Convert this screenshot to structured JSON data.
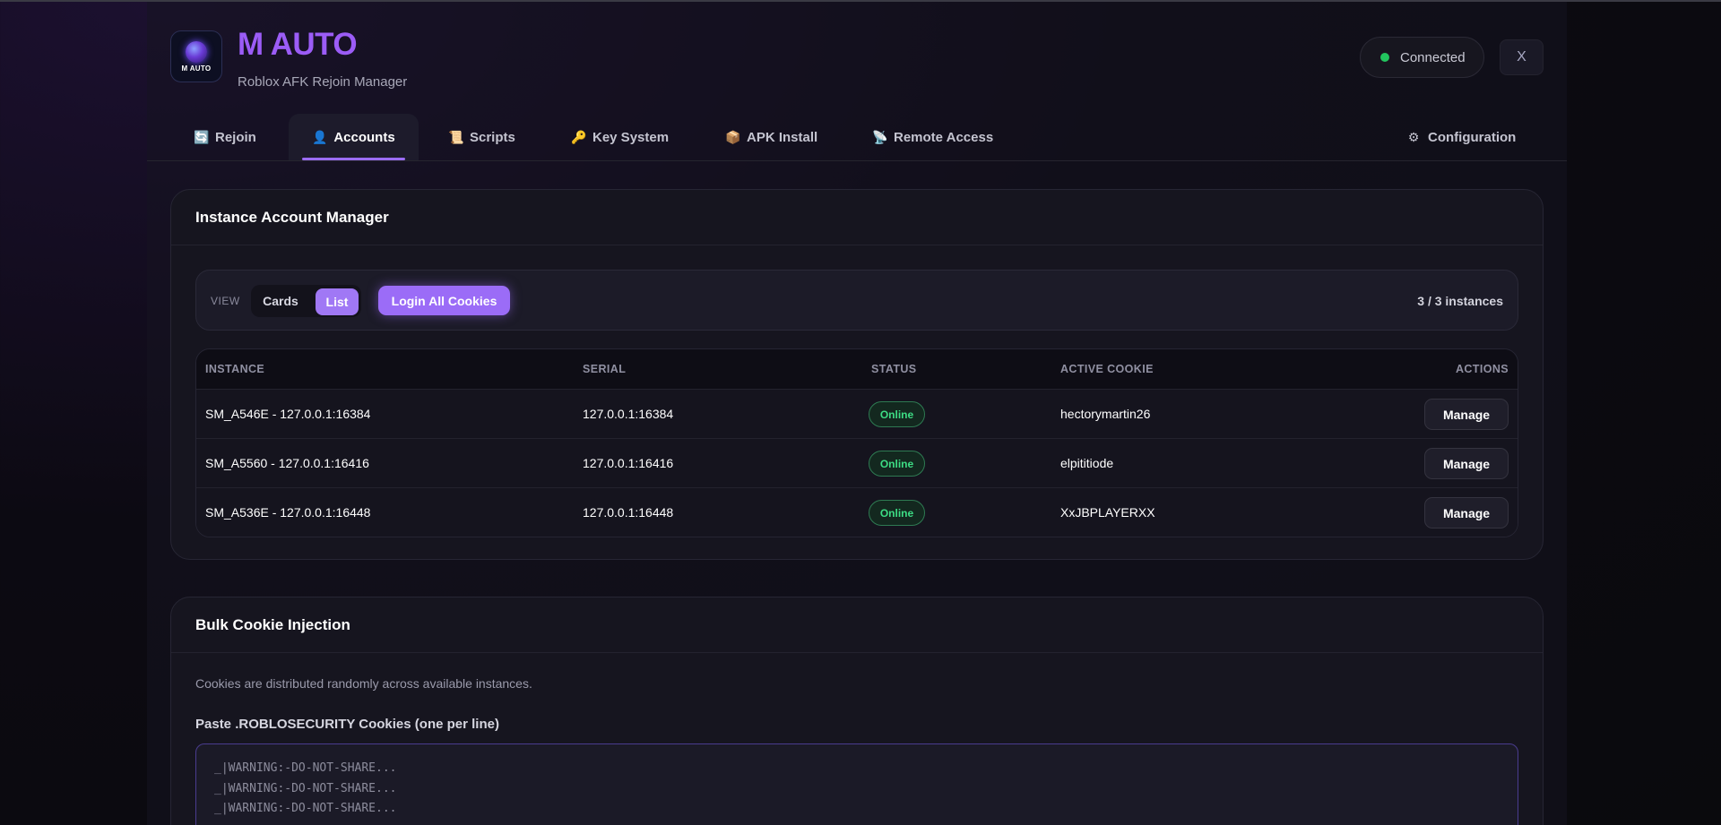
{
  "app": {
    "logo_text": "M AUTO",
    "title": "M AUTO",
    "subtitle": "Roblox AFK Rejoin Manager",
    "status": "Connected",
    "close_label": "X"
  },
  "tabs": [
    {
      "icon": "🔄",
      "label": "Rejoin"
    },
    {
      "icon": "👤",
      "label": "Accounts"
    },
    {
      "icon": "📜",
      "label": "Scripts"
    },
    {
      "icon": "🔑",
      "label": "Key System"
    },
    {
      "icon": "📦",
      "label": "APK Install"
    },
    {
      "icon": "📡",
      "label": "Remote Access"
    },
    {
      "icon": "⚙",
      "label": "Configuration"
    }
  ],
  "active_tab": "Accounts",
  "accounts": {
    "title": "Instance Account Manager",
    "view_label": "VIEW",
    "view_cards": "Cards",
    "view_list": "List",
    "login_all": "Login All Cookies",
    "count": "3 / 3 instances",
    "columns": [
      "INSTANCE",
      "SERIAL",
      "STATUS",
      "ACTIVE COOKIE",
      "ACTIONS"
    ],
    "rows": [
      {
        "instance": "SM_A546E - 127.0.0.1:16384",
        "serial": "127.0.0.1:16384",
        "status": "Online",
        "cookie": "hectorymartin26",
        "action": "Manage"
      },
      {
        "instance": "SM_A5560 - 127.0.0.1:16416",
        "serial": "127.0.0.1:16416",
        "status": "Online",
        "cookie": "elpititiode",
        "action": "Manage"
      },
      {
        "instance": "SM_A536E - 127.0.0.1:16448",
        "serial": "127.0.0.1:16448",
        "status": "Online",
        "cookie": "XxJBPLAYERXX",
        "action": "Manage"
      }
    ]
  },
  "bulk": {
    "title": "Bulk Cookie Injection",
    "description": "Cookies are distributed randomly across available instances.",
    "field_label": "Paste .ROBLOSECURITY Cookies (one per line)",
    "lines": [
      "_|WARNING:-DO-NOT-SHARE...",
      "_|WARNING:-DO-NOT-SHARE...",
      "_|WARNING:-DO-NOT-SHARE..."
    ]
  },
  "colors": {
    "accent": "#9b6cf7",
    "title": "#9b5cf6",
    "online": "#3ddc84",
    "connected_dot": "#22c55e"
  }
}
